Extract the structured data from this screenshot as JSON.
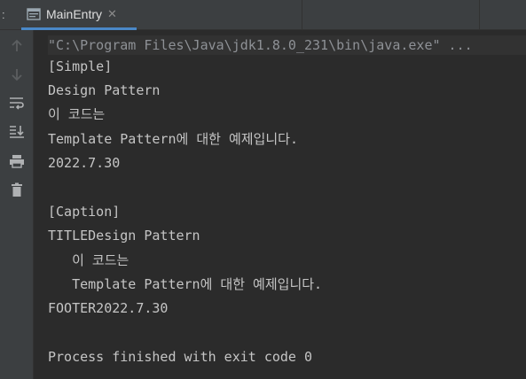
{
  "tab": {
    "prefix": ":",
    "title": "MainEntry",
    "close_glyph": "✕",
    "icon": "console-window-icon"
  },
  "toolbar": {
    "buttons": [
      {
        "name": "up-arrow-icon",
        "label": "Up the stack trace"
      },
      {
        "name": "down-arrow-icon",
        "label": "Down the stack trace"
      },
      {
        "name": "soft-wrap-icon",
        "label": "Soft-wrap"
      },
      {
        "name": "scroll-to-end-icon",
        "label": "Scroll to the end"
      },
      {
        "name": "print-icon",
        "label": "Print"
      },
      {
        "name": "trash-icon",
        "label": "Clear all"
      }
    ]
  },
  "console": {
    "command": "\"C:\\Program Files\\Java\\jdk1.8.0_231\\bin\\java.exe\" ...",
    "lines": [
      "[Simple]",
      "Design Pattern",
      "이 코드는",
      "Template Pattern에 대한 예제입니다.",
      "2022.7.30",
      "",
      "[Caption]",
      "TITLEDesign Pattern",
      "   이 코드는",
      "   Template Pattern에 대한 예제입니다.",
      "FOOTER2022.7.30",
      "",
      "Process finished with exit code 0"
    ]
  },
  "colors": {
    "background": "#2b2b2b",
    "panel": "#3c3f41",
    "tab_underline": "#4a88c7",
    "text": "#c5c5c5",
    "command_text": "#8e9196"
  }
}
